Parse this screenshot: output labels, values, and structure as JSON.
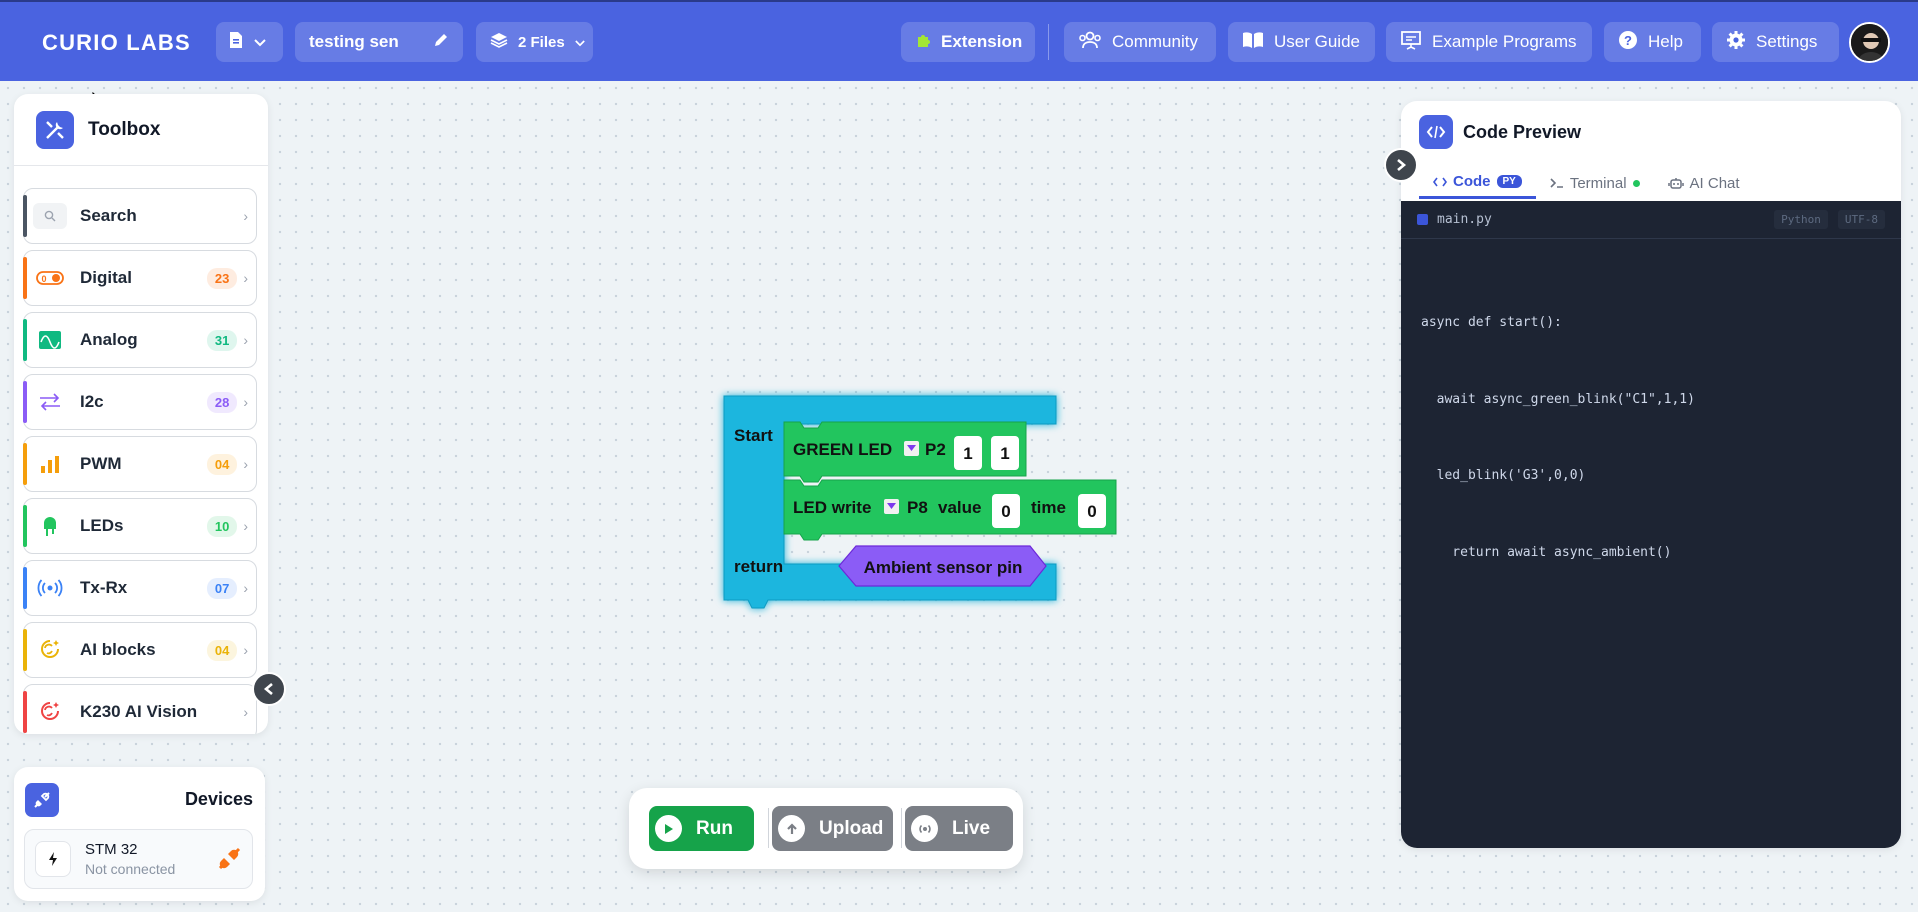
{
  "app": {
    "brand": "CURIO LABS",
    "project_name": "testing sen",
    "files_label": "2 Files"
  },
  "header": {
    "extension_label": "Extension",
    "community_label": "Community",
    "user_guide_label": "User Guide",
    "example_programs_label": "Example Programs",
    "help_label": "Help",
    "settings_label": "Settings"
  },
  "toolbox": {
    "title": "Toolbox",
    "search_label": "Search",
    "categories": [
      {
        "label": "Digital",
        "count": "23",
        "color": "#f97316",
        "icon": "toggle-icon"
      },
      {
        "label": "Analog",
        "count": "31",
        "color": "#10b981",
        "icon": "wave-icon"
      },
      {
        "label": "I2c",
        "count": "28",
        "color": "#8b5cf6",
        "icon": "i2c-icon"
      },
      {
        "label": "PWM",
        "count": "04",
        "color": "#f59e0b",
        "icon": "bars-icon"
      },
      {
        "label": "LEDs",
        "count": "10",
        "color": "#22c55e",
        "icon": "led-icon"
      },
      {
        "label": "Tx-Rx",
        "count": "07",
        "color": "#3b82f6",
        "icon": "broadcast-icon"
      },
      {
        "label": "AI blocks",
        "count": "04",
        "color": "#eab308",
        "icon": "ai-icon"
      },
      {
        "label": "K230 AI Vision",
        "count": "",
        "color": "#ef4444",
        "icon": "ai-icon"
      }
    ]
  },
  "devices": {
    "title": "Devices",
    "device_name": "STM 32",
    "device_status": "Not connected"
  },
  "blocks": {
    "start_label": "Start",
    "return_label": "return",
    "green_led": {
      "label": "GREEN LED",
      "pin": "P2",
      "arg1": "1",
      "arg2": "1"
    },
    "led_write": {
      "label": "LED write",
      "pin": "P8",
      "value_label": "value",
      "value": "0",
      "time_label": "time",
      "time": "0"
    },
    "ambient": {
      "label": "Ambient sensor pin"
    }
  },
  "runbar": {
    "run_label": "Run",
    "upload_label": "Upload",
    "live_label": "Live"
  },
  "code_preview": {
    "title": "Code Preview",
    "tabs": {
      "code": "Code",
      "code_badge": "PY",
      "terminal": "Terminal",
      "ai_chat": "AI Chat"
    },
    "file_name": "main.py",
    "language": "Python",
    "encoding": "UTF-8",
    "code_lines": [
      "async def start():",
      "  await async_green_blink(\"C1\",1,1)",
      "  led_blink('G3',0,0)",
      "    return await async_ambient()"
    ]
  },
  "colors": {
    "brand_blue": "#4a63e0",
    "block_cyan": "#1bb6de",
    "block_green": "#22c55e",
    "block_purple": "#8b5cf6",
    "run_green": "#16a34a",
    "button_gray": "#7b7f86"
  }
}
